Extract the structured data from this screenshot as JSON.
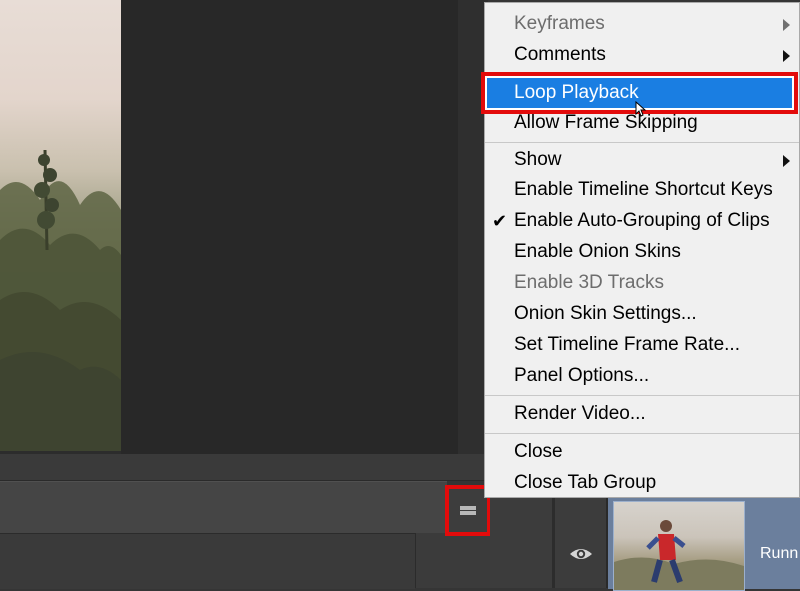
{
  "menu": {
    "items": [
      {
        "label": "Keyframes",
        "disabled": true,
        "submenu": true
      },
      {
        "label": "Comments",
        "disabled": false,
        "submenu": true
      },
      {
        "label": "Loop Playback",
        "highlighted": true
      },
      {
        "label": "Allow Frame Skipping"
      },
      {
        "label": "Show",
        "submenu": true
      },
      {
        "label": "Enable Timeline Shortcut Keys"
      },
      {
        "label": "Enable Auto-Grouping of Clips",
        "checked": true,
        "check_glyph": "✔"
      },
      {
        "label": "Enable Onion Skins"
      },
      {
        "label": "Enable 3D Tracks",
        "disabled": true
      },
      {
        "label": "Onion Skin Settings..."
      },
      {
        "label": "Set Timeline Frame Rate..."
      },
      {
        "label": "Panel Options..."
      },
      {
        "label": "Render Video..."
      },
      {
        "label": "Close"
      },
      {
        "label": "Close Tab Group"
      }
    ]
  },
  "timeline": {
    "clip_label": "Runn",
    "panel_menu_icon": "hamburger-menu-icon",
    "visibility_icon": "eye-icon"
  },
  "colors": {
    "highlight": "#1a7ee2",
    "annotation": "#e30b0b",
    "menu_bg": "#f0f0f0",
    "clip": "#6b7f9d"
  }
}
